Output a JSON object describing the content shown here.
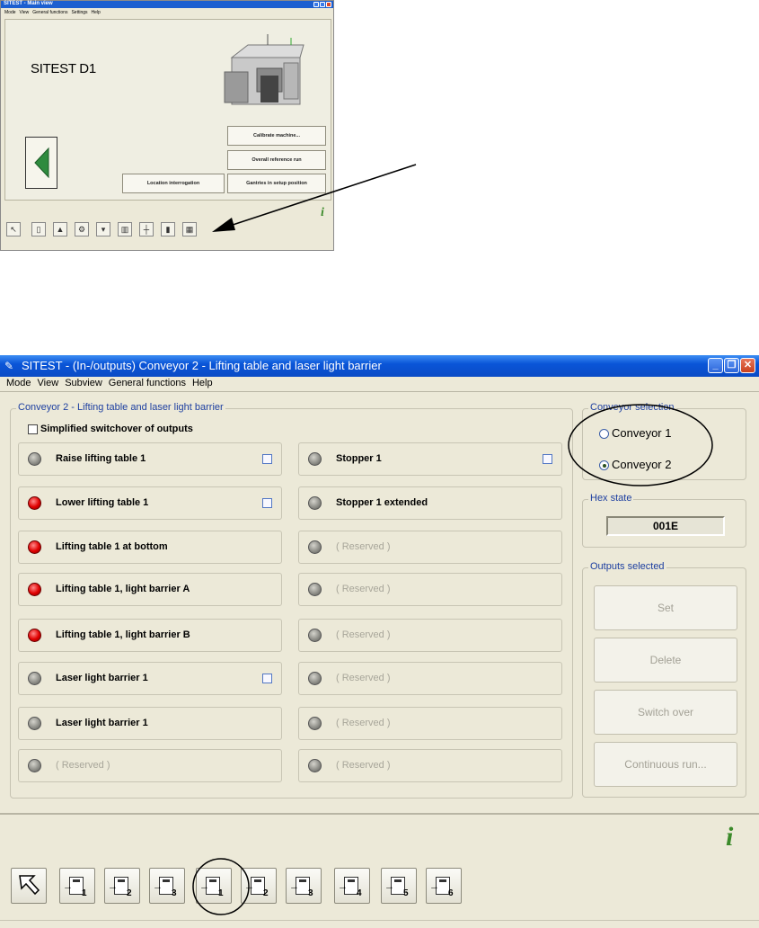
{
  "main_view": {
    "window_title": "SITEST - Main view",
    "menu": [
      "Mode",
      "View",
      "General functions",
      "Settings",
      "Help"
    ],
    "machine_name": "SITEST D1",
    "buttons": {
      "calibrate": "Calibrate machine...",
      "reference_run": "Overall reference run",
      "location": "Location interrogation",
      "gantries": "Gantries in setup position"
    },
    "toolbar_icons": [
      "pointer-icon",
      "station-icon",
      "component-icon",
      "settings-gear-icon",
      "conveyor-down-icon",
      "feeder-icon",
      "axis-icon",
      "panel-icon",
      "inputs-outputs-icon"
    ]
  },
  "io_view": {
    "window_title": "SITEST - (In-/outputs) Conveyor 2 - Lifting table and laser light barrier",
    "menu": [
      "Mode",
      "View",
      "Subview",
      "General functions",
      "Help"
    ],
    "group_title": "Conveyor 2 - Lifting table and laser light barrier",
    "simplified_label": "Simplified switchover of outputs",
    "left_column": [
      {
        "label": "Raise lifting table 1",
        "led": "gray",
        "checkbox": true,
        "reserved": false
      },
      {
        "label": "Lower lifting table 1",
        "led": "red",
        "checkbox": true,
        "reserved": false
      },
      {
        "label": "Lifting table 1 at bottom",
        "led": "red",
        "checkbox": false,
        "reserved": false
      },
      {
        "label": "Lifting table 1, light barrier A",
        "led": "red",
        "checkbox": false,
        "reserved": false
      },
      {
        "label": "Lifting table 1, light barrier B",
        "led": "red",
        "checkbox": false,
        "reserved": false
      },
      {
        "label": "Laser light barrier 1",
        "led": "gray",
        "checkbox": true,
        "reserved": false
      },
      {
        "label": "Laser light barrier 1",
        "led": "gray",
        "checkbox": false,
        "reserved": false
      },
      {
        "label": "( Reserved )",
        "led": "gray",
        "checkbox": false,
        "reserved": true
      }
    ],
    "right_column": [
      {
        "label": "Stopper 1",
        "led": "gray",
        "checkbox": true,
        "reserved": false
      },
      {
        "label": "Stopper 1 extended",
        "led": "gray",
        "checkbox": false,
        "reserved": false
      },
      {
        "label": "( Reserved )",
        "led": "gray",
        "checkbox": false,
        "reserved": true
      },
      {
        "label": "( Reserved )",
        "led": "gray",
        "checkbox": false,
        "reserved": true
      },
      {
        "label": "( Reserved )",
        "led": "gray",
        "checkbox": false,
        "reserved": true
      },
      {
        "label": "( Reserved )",
        "led": "gray",
        "checkbox": false,
        "reserved": true
      },
      {
        "label": "( Reserved )",
        "led": "gray",
        "checkbox": false,
        "reserved": true
      },
      {
        "label": "( Reserved )",
        "led": "gray",
        "checkbox": false,
        "reserved": true
      }
    ],
    "conveyor_selection": {
      "title": "Conveyor selection",
      "options": [
        "Conveyor 1",
        "Conveyor 2"
      ],
      "selected": "Conveyor 2"
    },
    "hex_state": {
      "title": "Hex state",
      "value": "001E"
    },
    "outputs_selected": {
      "title": "Outputs selected",
      "buttons": [
        "Set",
        "Delete",
        "Switch over",
        "Continuous run..."
      ]
    },
    "toolbar_numbers": [
      "1",
      "2",
      "3",
      "1",
      "2",
      "3",
      "4",
      "5",
      "6"
    ]
  },
  "colors": {
    "led_red": "#e00000",
    "led_gray": "#8a8a84",
    "title_blue": "#0a55d8",
    "group_legend": "#1c3ea0"
  }
}
